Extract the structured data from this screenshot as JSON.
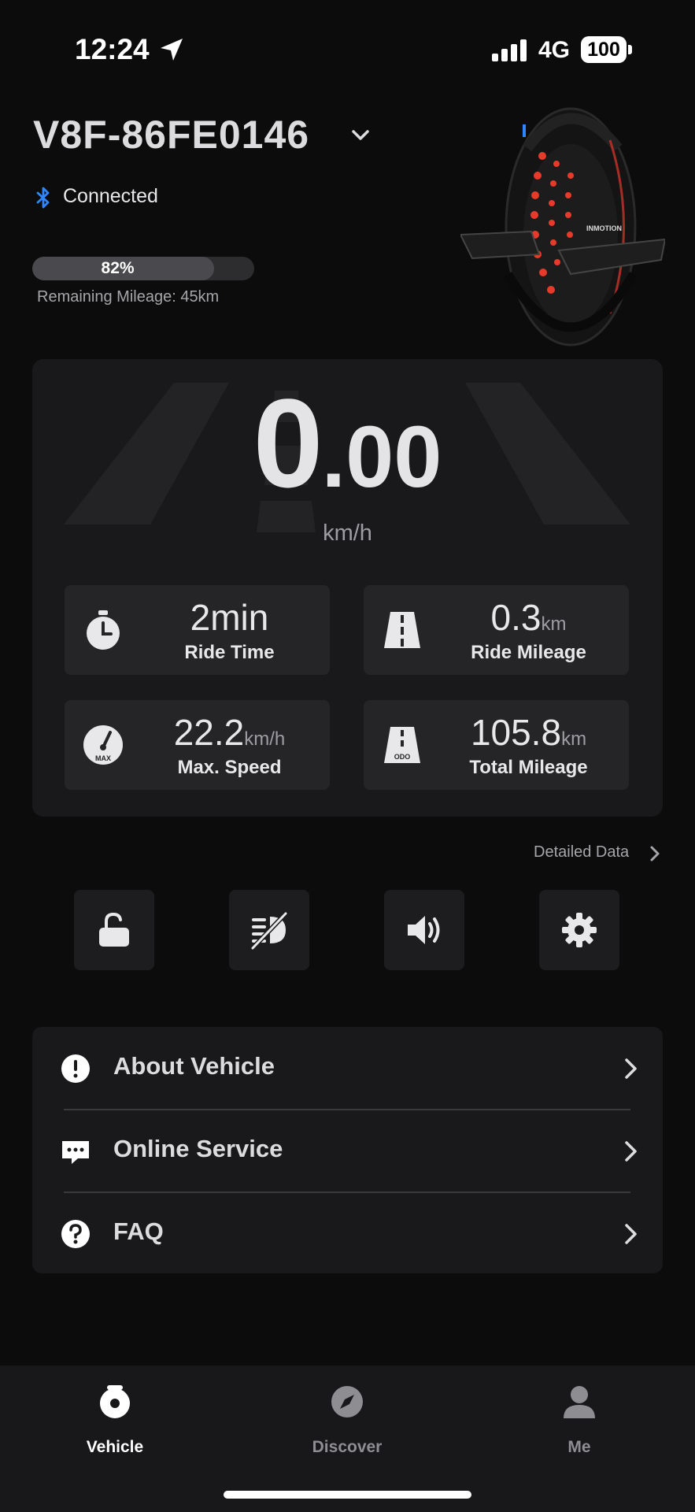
{
  "status_bar": {
    "time": "12:24",
    "network": "4G",
    "battery": "100"
  },
  "vehicle": {
    "name": "V8F-86FE0146",
    "connection": "Connected",
    "battery_percent": 82,
    "battery_label": "82%",
    "remaining_mileage": "Remaining Mileage: 45km",
    "image_brand_text": "INMOTION"
  },
  "speed": {
    "whole": "0",
    "fraction": ".00",
    "unit": "km/h"
  },
  "stats": [
    {
      "value": "2min",
      "unit": "",
      "label": "Ride Time",
      "icon": "stopwatch-icon"
    },
    {
      "value": "0.3",
      "unit": "km",
      "label": "Ride Mileage",
      "icon": "road-icon"
    },
    {
      "value": "22.2",
      "unit": "km/h",
      "label": "Max. Speed",
      "icon": "speedometer-max-icon",
      "icon_text": "MAX"
    },
    {
      "value": "105.8",
      "unit": "km",
      "label": "Total Mileage",
      "icon": "road-odo-icon",
      "icon_text": "ODO"
    }
  ],
  "detailed_data_label": "Detailed Data",
  "controls": [
    {
      "name": "unlock-button",
      "icon": "unlock-icon"
    },
    {
      "name": "light-off-button",
      "icon": "headlight-off-icon"
    },
    {
      "name": "sound-button",
      "icon": "speaker-icon"
    },
    {
      "name": "settings-button",
      "icon": "gear-icon"
    }
  ],
  "menu": [
    {
      "label": "About Vehicle",
      "icon": "info-exclamation-icon"
    },
    {
      "label": "Online Service",
      "icon": "chat-icon"
    },
    {
      "label": "FAQ",
      "icon": "question-icon"
    }
  ],
  "tabs": [
    {
      "label": "Vehicle",
      "active": true,
      "icon": "unicycle-icon"
    },
    {
      "label": "Discover",
      "active": false,
      "icon": "compass-icon"
    },
    {
      "label": "Me",
      "active": false,
      "icon": "person-icon"
    }
  ],
  "colors": {
    "background": "#0c0c0d",
    "panel": "#19191b",
    "card": "#252527",
    "bluetooth": "#2f86ff",
    "wheel_led": "#e83a2a",
    "tab_active": "#ffffff",
    "tab_inactive": "#8e8e92"
  }
}
